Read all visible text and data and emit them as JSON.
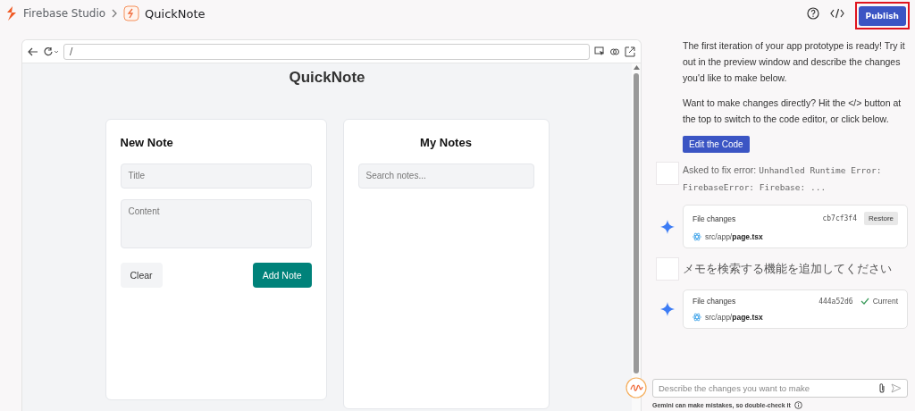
{
  "header": {
    "brand": "Firebase Studio",
    "app_name": "QuickNote",
    "publish": {
      "label": "Publish",
      "highlighted": true
    }
  },
  "preview": {
    "url": "/",
    "app_title": "QuickNote",
    "new_note": {
      "heading": "New Note",
      "title_placeholder": "Title",
      "content_placeholder": "Content",
      "buttons": [
        {
          "kind": "secondary",
          "label": "Clear"
        },
        {
          "kind": "primary",
          "label": "Add Note"
        }
      ]
    },
    "my_notes": {
      "heading": "My Notes",
      "search_placeholder": "Search notes..."
    }
  },
  "chat": {
    "messages": [
      {
        "kind": "text",
        "text": "The first iteration of your app prototype is ready! Try it out in the preview window and describe the changes you'd like to make below."
      },
      {
        "kind": "text",
        "text": "Want to make changes directly? Hit the </> button at the top to switch to the code editor, or click below."
      },
      {
        "kind": "button",
        "label": "Edit the Code"
      },
      {
        "kind": "user_error",
        "prefix": "Asked to fix error:",
        "code": "Unhandled Runtime Error: FirebaseError: Firebase: ..."
      },
      {
        "kind": "file_changes",
        "label": "File changes",
        "commit": "cb7cf3f4",
        "action": {
          "kind": "button",
          "label": "Restore"
        },
        "path_dir": "src/app/",
        "path_file": "page.tsx"
      },
      {
        "kind": "user",
        "text": "メモを検索する機能を追加してください"
      },
      {
        "kind": "file_changes",
        "label": "File changes",
        "commit": "444a52d6",
        "action": {
          "kind": "status",
          "label": "Current"
        },
        "path_dir": "src/app/",
        "path_file": "page.tsx"
      }
    ],
    "input_placeholder": "Describe the changes you want to make",
    "disclaimer": "Gemini can make mistakes, so double-check it"
  }
}
